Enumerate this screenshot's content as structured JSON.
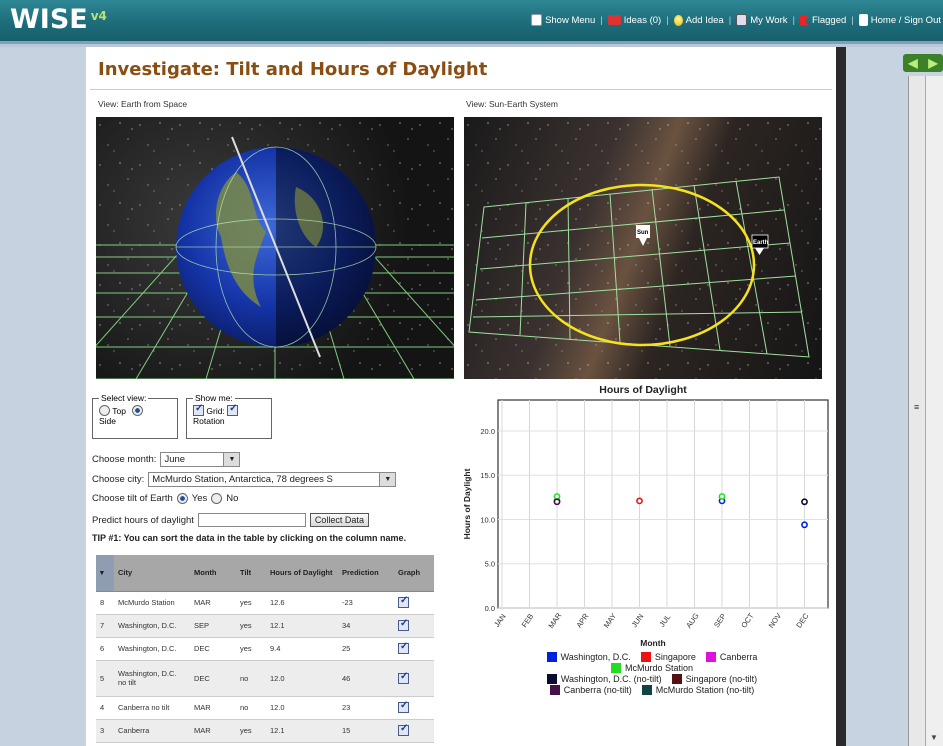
{
  "app": {
    "logo": "WISE",
    "version": "v4"
  },
  "topnav": {
    "show_menu": "Show Menu",
    "ideas": "Ideas (0)",
    "add_idea": "Add Idea",
    "my_work": "My Work",
    "flagged": "Flagged",
    "home_signout": "Home / Sign Out"
  },
  "page": {
    "title": "Investigate: Tilt and Hours of Daylight",
    "view_left": "View: Earth from Space",
    "view_right": "View: Sun-Earth System",
    "sun_label": "Sun",
    "earth_label": "Earth"
  },
  "controls": {
    "select_view": {
      "legend": "Select view:",
      "top": "Top",
      "side": "Side",
      "selected": "Side"
    },
    "show_me": {
      "legend": "Show me:",
      "grid": "Grid:",
      "rotation": "Rotation"
    },
    "month_label": "Choose month:",
    "month_value": "June",
    "city_label": "Choose city:",
    "city_value": "McMurdo Station, Antarctica, 78 degrees S",
    "tilt_label": "Choose tilt of Earth",
    "tilt_yes": "Yes",
    "tilt_no": "No",
    "predict_label": "Predict hours of daylight",
    "predict_value": "",
    "collect_button": "Collect Data",
    "tip": "TIP #1: You can sort the data in the table by clicking on the column name."
  },
  "table": {
    "headers": [
      "",
      "City",
      "Month",
      "Tilt",
      "Hours of Daylight",
      "Prediction",
      "Graph"
    ],
    "rows": [
      {
        "id": "8",
        "city": "McMurdo Station",
        "month": "MAR",
        "tilt": "yes",
        "hours": "12.6",
        "prediction": "-23"
      },
      {
        "id": "7",
        "city": "Washington, D.C.",
        "month": "SEP",
        "tilt": "yes",
        "hours": "12.1",
        "prediction": "34"
      },
      {
        "id": "6",
        "city": "Washington, D.C.",
        "month": "DEC",
        "tilt": "yes",
        "hours": "9.4",
        "prediction": "25"
      },
      {
        "id": "5",
        "city": "Washington, D.C. no tilt",
        "month": "DEC",
        "tilt": "no",
        "hours": "12.0",
        "prediction": "46"
      },
      {
        "id": "4",
        "city": "Canberra no tilt",
        "month": "MAR",
        "tilt": "no",
        "hours": "12.0",
        "prediction": "23"
      },
      {
        "id": "3",
        "city": "Canberra",
        "month": "MAR",
        "tilt": "yes",
        "hours": "12.1",
        "prediction": "15"
      }
    ]
  },
  "chart_data": {
    "type": "scatter",
    "title": "Hours of Daylight",
    "xlabel": "Month",
    "ylabel": "Hours of Daylight",
    "categories": [
      "JAN",
      "FEB",
      "MAR",
      "APR",
      "MAY",
      "JUN",
      "JUL",
      "AUG",
      "SEP",
      "OCT",
      "NOV",
      "DEC"
    ],
    "y_ticks": [
      "0.0",
      "5.0",
      "10.0",
      "15.0",
      "20.0"
    ],
    "ylim": [
      0,
      23.5
    ],
    "grid": true,
    "legend_position": "bottom",
    "series": [
      {
        "name": "Washington, D.C.",
        "color": "#0022dd",
        "points": [
          [
            "SEP",
            12.1
          ],
          [
            "DEC",
            9.4
          ]
        ]
      },
      {
        "name": "Singapore",
        "color": "#ee1111",
        "points": [
          [
            "JUN",
            12.1
          ]
        ]
      },
      {
        "name": "Canberra",
        "color": "#dd11dd",
        "points": [
          [
            "MAR",
            12.1
          ]
        ]
      },
      {
        "name": "McMurdo Station",
        "color": "#22dd22",
        "points": [
          [
            "MAR",
            12.6
          ],
          [
            "SEP",
            12.6
          ]
        ]
      },
      {
        "name": "Washington, D.C. (no-tilt)",
        "color": "#0a0a33",
        "points": [
          [
            "DEC",
            12.0
          ]
        ]
      },
      {
        "name": "Singapore (no-tilt)",
        "color": "#551111",
        "points": []
      },
      {
        "name": "Canberra (no-tilt)",
        "color": "#441144",
        "points": [
          [
            "MAR",
            12.0
          ]
        ]
      },
      {
        "name": "McMurdo Station (no-tilt)",
        "color": "#114444",
        "points": []
      }
    ]
  }
}
